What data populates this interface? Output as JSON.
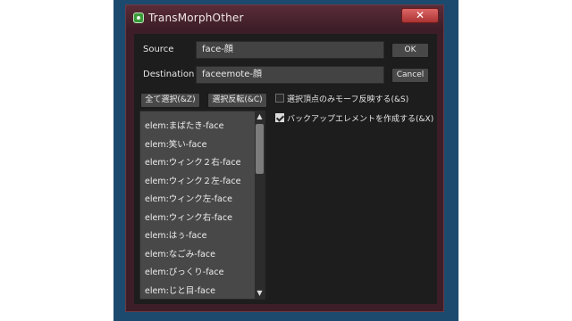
{
  "window": {
    "title": "TransMorphOther",
    "close_glyph": "✕"
  },
  "source": {
    "label": "Source",
    "value": "face-顔"
  },
  "destination": {
    "label": "Destination",
    "value": "faceemote-顔"
  },
  "buttons": {
    "ok": "OK",
    "cancel": "Cancel",
    "select_all": "全て選択(&Z)",
    "invert_selection": "選択反転(&C)"
  },
  "options": [
    {
      "label": "選択頂点のみモーフ反映する(&S)",
      "checked": false
    },
    {
      "label": "バックアップエレメントを作成する(&X)",
      "checked": true
    }
  ],
  "list": {
    "items": [
      "elem:まばたき-face",
      "elem:笑い-face",
      "elem:ウィンク２右-face",
      "elem:ウィンク２左-face",
      "elem:ウィンク左-face",
      "elem:ウィンク右-face",
      "elem:はぅ-face",
      "elem:なごみ-face",
      "elem:びっくり-face",
      "elem:じと目-face"
    ],
    "scroll_up_glyph": "▲",
    "scroll_down_glyph": "▼"
  }
}
